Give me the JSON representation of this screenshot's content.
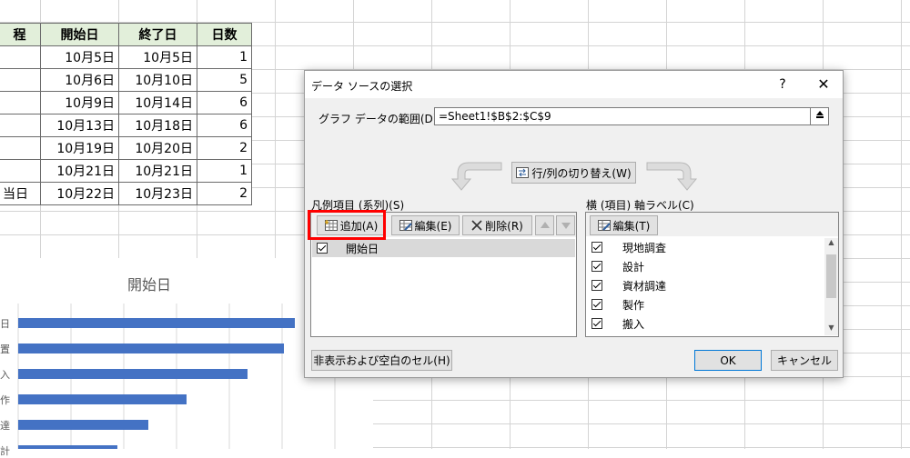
{
  "sheet": {
    "headers": [
      "",
      "開始日",
      "終了日",
      "日数"
    ],
    "header_partial": "程",
    "rows": [
      {
        "name": "",
        "start": "10月5日",
        "end": "10月5日",
        "days": "1"
      },
      {
        "name": "",
        "start": "10月6日",
        "end": "10月10日",
        "days": "5"
      },
      {
        "name": "",
        "start": "10月9日",
        "end": "10月14日",
        "days": "6"
      },
      {
        "name": "",
        "start": "10月13日",
        "end": "10月18日",
        "days": "6"
      },
      {
        "name": "",
        "start": "10月19日",
        "end": "10月20日",
        "days": "2"
      },
      {
        "name": "",
        "start": "10月21日",
        "end": "10月21日",
        "days": "1"
      },
      {
        "name": "当日",
        "start": "10月22日",
        "end": "10月23日",
        "days": "2"
      }
    ]
  },
  "chart": {
    "title": "開始日",
    "ylabels": [
      "日",
      "置",
      "入",
      "作",
      "達",
      "計"
    ]
  },
  "chart_data": {
    "type": "bar",
    "orientation": "horizontal",
    "title": "開始日",
    "categories": [
      "日",
      "置",
      "入",
      "作",
      "達",
      "計"
    ],
    "values": [
      1.0,
      0.96,
      0.83,
      0.61,
      0.47,
      0.36
    ],
    "color": "#4472c4"
  },
  "dialog": {
    "title": "データ ソースの選択",
    "help": "?",
    "close": "✕",
    "range_label": "グラフ データの範囲(D):",
    "range_value": "=Sheet1!$B$2:$C$9",
    "switch_label": "行/列の切り替え(W)",
    "legend_label": "凡例項目 (系列)(S)",
    "add_label": "追加(A)",
    "edit_label": "編集(E)",
    "delete_label": "削除(R)",
    "series": [
      "開始日"
    ],
    "axis_label": "横 (項目) 軸ラベル(C)",
    "axis_edit_label": "編集(T)",
    "axis_items": [
      "現地調査",
      "設計",
      "資材調達",
      "製作",
      "搬入"
    ],
    "hidden_cells_label": "非表示および空白のセル(H)",
    "ok_label": "OK",
    "cancel_label": "キャンセル"
  },
  "colors": {
    "highlight": "#ff0000",
    "bar": "#4472c4",
    "header_fill": "#e2efda"
  }
}
